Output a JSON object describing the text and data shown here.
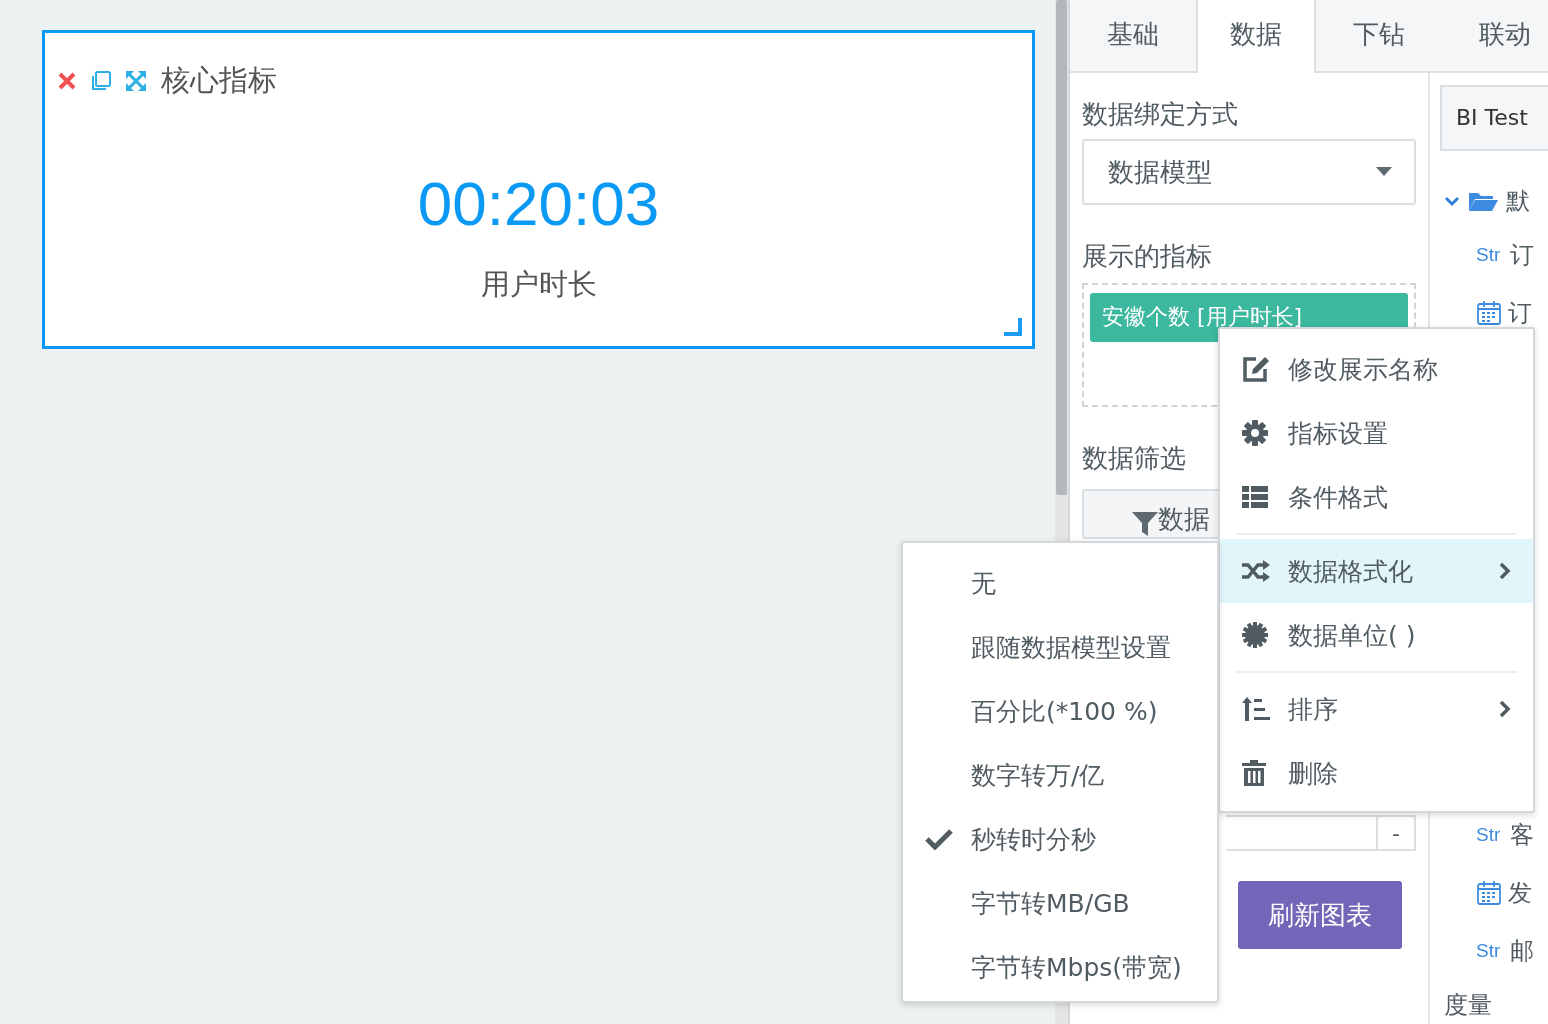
{
  "widget": {
    "title": "核心指标",
    "value": "00:20:03",
    "label": "用户时长",
    "selected": true
  },
  "tabs": [
    {
      "label": "基础",
      "selected": false
    },
    {
      "label": "数据",
      "selected": true
    },
    {
      "label": "下钻",
      "selected": false
    },
    {
      "label": "联动",
      "selected": false
    }
  ],
  "binding": {
    "label": "数据绑定方式",
    "value": "数据模型"
  },
  "metrics": {
    "label": "展示的指标",
    "items": [
      {
        "label": "安徽个数 [用户时长]"
      }
    ]
  },
  "filter": {
    "label": "数据筛选",
    "button": "数据"
  },
  "range_button": "-",
  "refresh_button": "刷新图表",
  "source": {
    "name": "BI Test"
  },
  "tree": {
    "folder": {
      "label": "默",
      "expanded": true
    },
    "fields": [
      {
        "kind": "string",
        "type_label": "Str",
        "label": "订"
      },
      {
        "kind": "date",
        "label": "订"
      },
      {
        "kind": "string",
        "type_label": "Str",
        "label": "客"
      },
      {
        "kind": "date",
        "label": "发"
      },
      {
        "kind": "string",
        "type_label": "Str",
        "label": "邮"
      }
    ]
  },
  "measures_label": "度量",
  "context_menu": [
    [
      {
        "label": "修改展示名称",
        "selected": false,
        "has_submenu": false
      },
      {
        "label": "指标设置",
        "selected": false,
        "has_submenu": false
      },
      {
        "label": "条件格式",
        "selected": false,
        "has_submenu": false
      }
    ],
    [
      {
        "label": "数据格式化",
        "selected": true,
        "has_submenu": true
      },
      {
        "label": "数据单位( )",
        "selected": false,
        "has_submenu": false
      }
    ],
    [
      {
        "label": "排序",
        "selected": false,
        "has_submenu": true
      },
      {
        "label": "删除",
        "selected": false,
        "has_submenu": false
      }
    ]
  ],
  "format_submenu": [
    {
      "label": "无",
      "checked": false
    },
    {
      "label": "跟随数据模型设置",
      "checked": false
    },
    {
      "label": "百分比(*100 %)",
      "checked": false
    },
    {
      "label": "数字转万/亿",
      "checked": false
    },
    {
      "label": "秒转时分秒",
      "checked": true
    },
    {
      "label": "字节转MB/GB",
      "checked": false
    },
    {
      "label": "字节转Mbps(带宽)",
      "checked": false
    }
  ]
}
